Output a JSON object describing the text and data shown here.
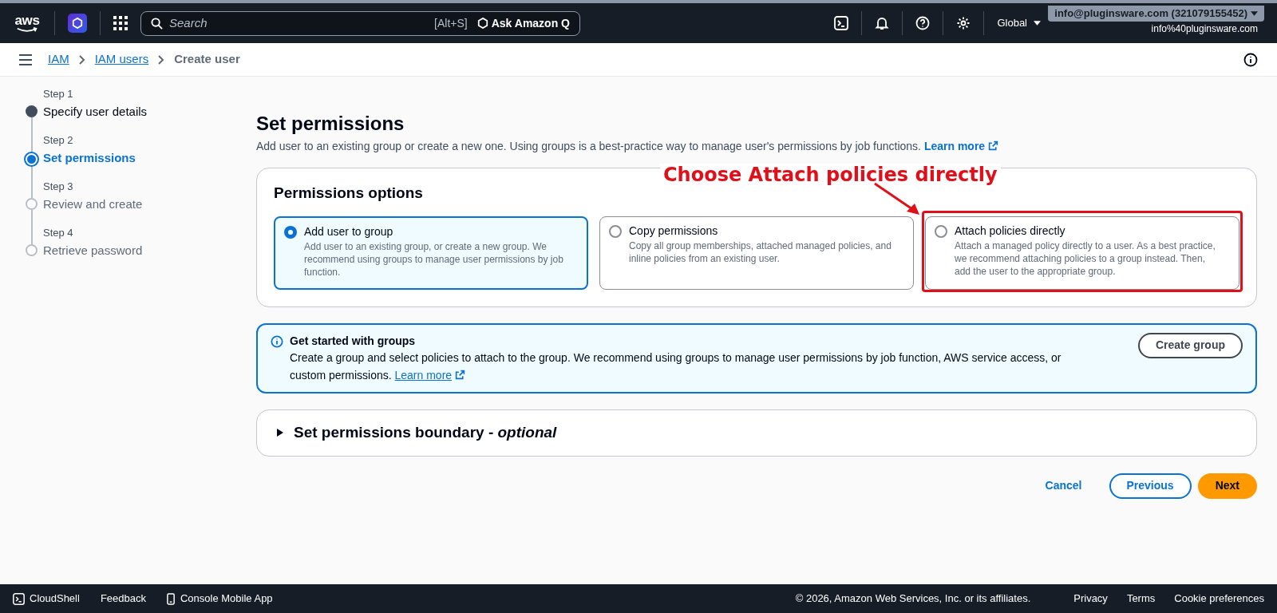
{
  "top_bar": {
    "logo": "aws",
    "search": {
      "placeholder": "Search",
      "shortcut": "[Alt+S]"
    },
    "ask_button": "Ask Amazon Q",
    "region": "Global",
    "account": "info@pluginsware.com (321079155452)",
    "user": "info%40pluginsware.com"
  },
  "breadcrumbs": [
    {
      "label": "IAM",
      "kind": "link"
    },
    {
      "label": "IAM users",
      "kind": "link"
    },
    {
      "label": "Create user",
      "kind": "current"
    }
  ],
  "steps": [
    {
      "caption": "Step 1",
      "label": "Specify user details",
      "kind": "done"
    },
    {
      "caption": "Step 2",
      "label": "Set permissions",
      "kind": "current"
    },
    {
      "caption": "Step 3",
      "label": "Review and create",
      "kind": "pending"
    },
    {
      "caption": "Step 4",
      "label": "Retrieve password",
      "kind": "pending"
    }
  ],
  "page": {
    "title": "Set permissions",
    "description": "Add user to an existing group or create a new one. Using groups is a best-practice way to manage user's permissions by job functions.",
    "learn_more": "Learn more"
  },
  "permissions_options": {
    "title": "Permissions options",
    "annotation": "Choose Attach policies directly",
    "options": [
      {
        "label": "Add user to group",
        "description": "Add user to an existing group, or create a new group. We recommend using groups to manage user permissions by job function.",
        "selected": true,
        "highlighted": false
      },
      {
        "label": "Copy permissions",
        "description": "Copy all group memberships, attached managed policies, and inline policies from an existing user.",
        "selected": false,
        "highlighted": false
      },
      {
        "label": "Attach policies directly",
        "description": "Attach a managed policy directly to a user. As a best practice, we recommend attaching policies to a group instead. Then, add the user to the appropriate group.",
        "selected": false,
        "highlighted": true
      }
    ]
  },
  "info_alert": {
    "title": "Get started with groups",
    "body": "Create a group and select policies to attach to the group. We recommend using groups to manage user permissions by job function, AWS service access, or custom permissions.",
    "learn_more": "Learn more",
    "button": "Create group"
  },
  "boundary": {
    "title": "Set permissions boundary - *optional*",
    "expanded": false
  },
  "actions": {
    "cancel": "Cancel",
    "previous": "Previous",
    "next": "Next"
  },
  "footer": {
    "cloudshell": "CloudShell",
    "feedback": "Feedback",
    "mobile_app": "Console Mobile App",
    "copyright": "© 2026, Amazon Web Services, Inc. or its affiliates.",
    "links": [
      "Privacy",
      "Terms",
      "Cookie preferences"
    ]
  }
}
